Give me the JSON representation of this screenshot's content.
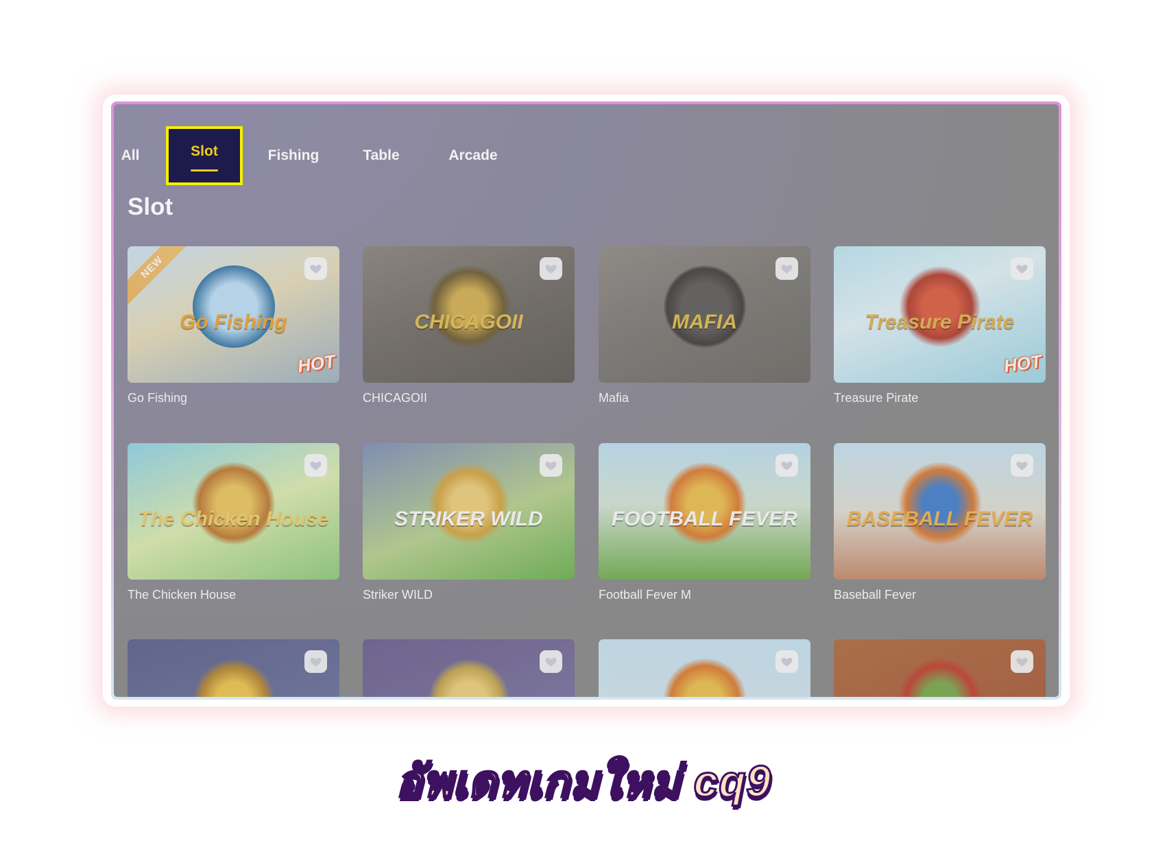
{
  "tabs": [
    {
      "label": "All",
      "active": false
    },
    {
      "label": "Slot",
      "active": true
    },
    {
      "label": "Fishing",
      "active": false
    },
    {
      "label": "Table",
      "active": false
    },
    {
      "label": "Arcade",
      "active": false
    }
  ],
  "section_title": "Slot",
  "games": [
    {
      "name": "Go Fishing",
      "logo": "Go Fishing",
      "badge_new": "NEW",
      "badge_hot": "HOT"
    },
    {
      "name": "CHICAGOII",
      "logo": "CHICAGOII",
      "badge_new": null,
      "badge_hot": null
    },
    {
      "name": "Mafia",
      "logo": "MAFIA",
      "badge_new": null,
      "badge_hot": null
    },
    {
      "name": "Treasure Pirate",
      "logo": "Treasure Pirate",
      "badge_new": null,
      "badge_hot": "HOT"
    },
    {
      "name": "The Chicken House",
      "logo": "The Chicken House",
      "badge_new": null,
      "badge_hot": null
    },
    {
      "name": "Striker WILD",
      "logo": "STRIKER WILD",
      "badge_new": null,
      "badge_hot": null
    },
    {
      "name": "Football Fever M",
      "logo": "FOOTBALL FEVER",
      "badge_new": null,
      "badge_hot": null
    },
    {
      "name": "Baseball Fever",
      "logo": "BASEBALL FEVER",
      "badge_new": null,
      "badge_hot": null
    },
    {
      "name": "",
      "logo": "",
      "badge_new": null,
      "badge_hot": null
    },
    {
      "name": "",
      "logo": "",
      "badge_new": null,
      "badge_hot": null
    },
    {
      "name": "",
      "logo": "",
      "badge_new": null,
      "badge_hot": null
    },
    {
      "name": "",
      "logo": "",
      "badge_new": null,
      "badge_hot": null
    }
  ],
  "colors": {
    "active_tab_bg": "#1d1a4c",
    "active_tab_border": "#f5f000",
    "active_tab_text": "#f2cc1c"
  },
  "page_title": "อัพเดทเกมใหม่ cq9"
}
